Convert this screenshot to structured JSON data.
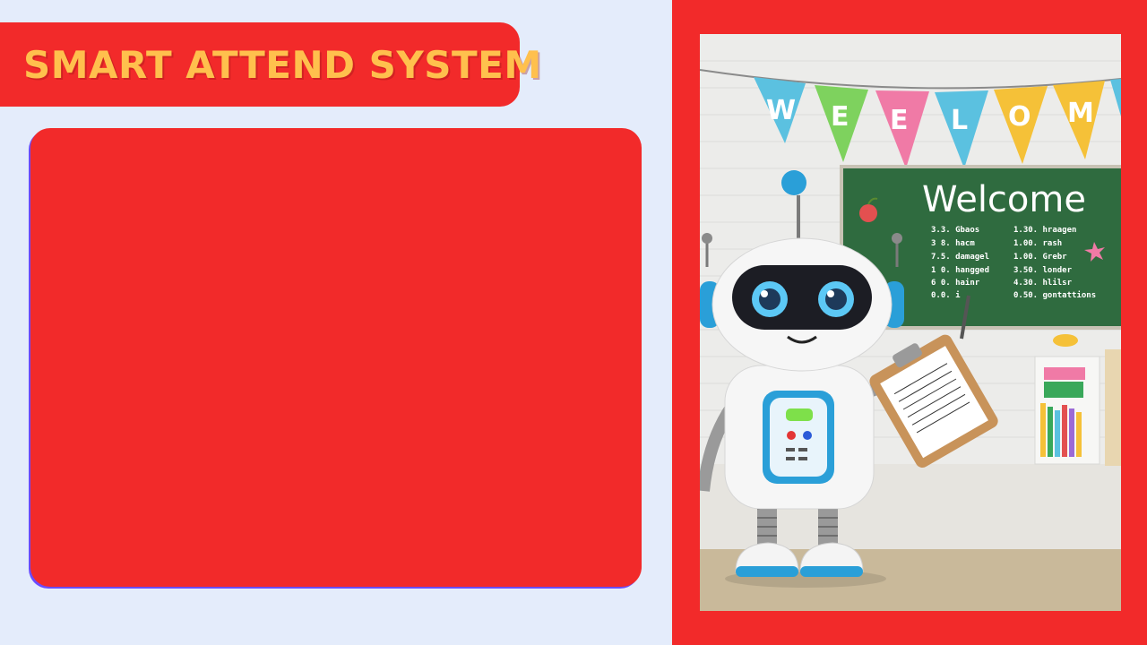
{
  "app": {
    "title": "SMART ATTEND SYSTEM"
  },
  "scene": {
    "bunting_letters": [
      "W",
      "E",
      "E",
      "L",
      "O",
      "M"
    ],
    "board_title": "Welcome",
    "board_left": [
      "3.3. Gbaos",
      "3 8. hacm",
      "7.5. damagel",
      "1 0. hangged",
      "6 0. hainr",
      "0.0. i"
    ],
    "board_right": [
      "1.30. hraagen",
      "1.00. rash",
      "1.00. Grebr",
      "3.50. londer",
      "4.30. hlilsr",
      "0.50. gontattions"
    ]
  },
  "colors": {
    "accent": "#f22a2a",
    "title": "#ffc04d",
    "background": "#e4ecfb",
    "board": "#2f6b3f"
  }
}
